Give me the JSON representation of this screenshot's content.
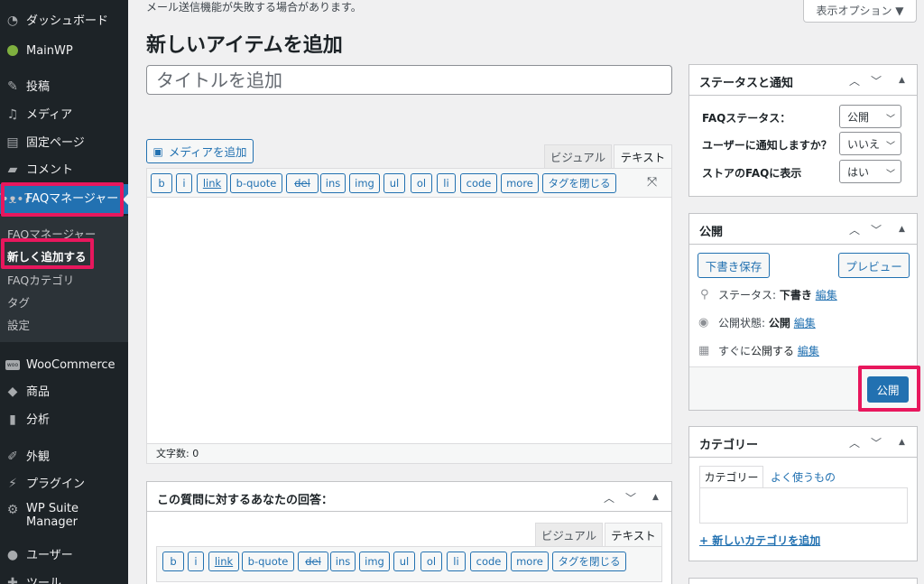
{
  "sidebar": {
    "items": [
      {
        "label": "ダッシュボード",
        "icon": "dashboard-icon"
      },
      {
        "label": "MainWP",
        "icon": "mainwp-icon"
      },
      {
        "label": "投稿",
        "icon": "pin-icon"
      },
      {
        "label": "メディア",
        "icon": "media-icon"
      },
      {
        "label": "固定ページ",
        "icon": "page-icon"
      },
      {
        "label": "コメント",
        "icon": "comment-icon"
      },
      {
        "label": "FAQマネージャー",
        "icon": "koala-icon"
      },
      {
        "label": "WooCommerce",
        "icon": "woo-icon"
      },
      {
        "label": "商品",
        "icon": "box-icon"
      },
      {
        "label": "分析",
        "icon": "bar-chart-icon"
      },
      {
        "label": "外観",
        "icon": "brush-icon"
      },
      {
        "label": "プラグイン",
        "icon": "plugin-icon"
      },
      {
        "label": "WP Suite Manager",
        "icon": "gear-icon"
      },
      {
        "label": "ユーザー",
        "icon": "user-icon"
      },
      {
        "label": "ツール",
        "icon": "wrench-icon"
      }
    ],
    "submenu": [
      "FAQマネージャー",
      "新しく追加する",
      "FAQカテゴリ",
      "タグ",
      "設定"
    ]
  },
  "header": {
    "notice": "メール送信機能が失敗する場合があります。",
    "screen_options": "表示オプション ▼",
    "page_title": "新しいアイテムを追加",
    "title_placeholder": "タイトルを追加"
  },
  "editor": {
    "add_media": "メディアを追加",
    "tab_visual": "ビジュアル",
    "tab_text": "テキスト",
    "quicktags": [
      "b",
      "i",
      "link",
      "b-quote",
      "del",
      "ins",
      "img",
      "ul",
      "ol",
      "li",
      "code",
      "more",
      "タグを閉じる"
    ],
    "word_count": "文字数: 0"
  },
  "answer_box": {
    "title": "この質問に対するあなたの回答：",
    "tab_visual": "ビジュアル",
    "tab_text": "テキスト"
  },
  "status_box": {
    "title": "ステータスと通知",
    "rows": [
      {
        "label": "FAQステータス：",
        "value": "公開"
      },
      {
        "label": "ユーザーに通知しますか？",
        "value": "いいえ"
      },
      {
        "label": "ストアのFAQに表示",
        "value": "はい"
      }
    ]
  },
  "publish_box": {
    "title": "公開",
    "save_draft": "下書き保存",
    "preview": "プレビュー",
    "status_label": "ステータス:",
    "status_value": "下書き",
    "visibility_label": "公開状態:",
    "visibility_value": "公開",
    "schedule_label": "すぐに",
    "schedule_suffix": "公開する",
    "edit": "編集",
    "publish": "公開"
  },
  "category_box": {
    "title": "カテゴリー",
    "tab_all": "カテゴリー",
    "tab_popular": "よく使うもの",
    "add_new": "+ 新しいカテゴリを追加"
  },
  "colors": {
    "accent": "#2271b1",
    "highlight": "#e8175d",
    "sidebar_bg": "#1d2327"
  }
}
